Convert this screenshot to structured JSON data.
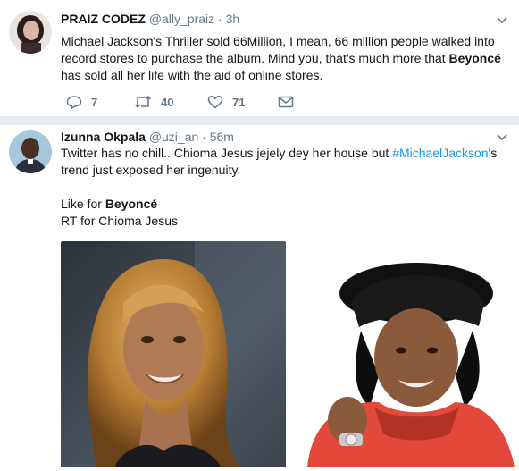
{
  "tweet1": {
    "name": "PRAIZ CODEZ",
    "handle": "@ally_praiz",
    "separator": "·",
    "time": "3h",
    "line1": "Michael Jackson's Thriller sold 66Million, I mean, 66 million people walked into",
    "line2": "record stores to purchase the album. Mind you, that's much more that ",
    "line2_bold": "Beyoncé",
    "line3": "has sold all her life with the aid of online stores.",
    "reply_icon": "reply-icon",
    "reply_count": "7",
    "retweet_icon": "retweet-icon",
    "retweet_count": "40",
    "like_icon": "heart-icon",
    "like_count": "71",
    "dm_icon": "envelope-icon"
  },
  "tweet2": {
    "name": "Izunna Okpala",
    "handle": "@uzi_an",
    "separator": "·",
    "time": "56m",
    "line1": "Twitter has no chill.. Chioma Jesus jejely dey her house but ",
    "hashtag": "#MichaelJackson",
    "line1_end": "'s",
    "line2": "trend just exposed her ingenuity.",
    "like_for": "Like for ",
    "like_for_bold": "Beyoncé",
    "rt_for": "RT for Chioma Jesus"
  },
  "colors": {
    "text": "#14171a",
    "muted": "#657786",
    "link": "#1b95e0",
    "divider": "#e6ecf0"
  }
}
